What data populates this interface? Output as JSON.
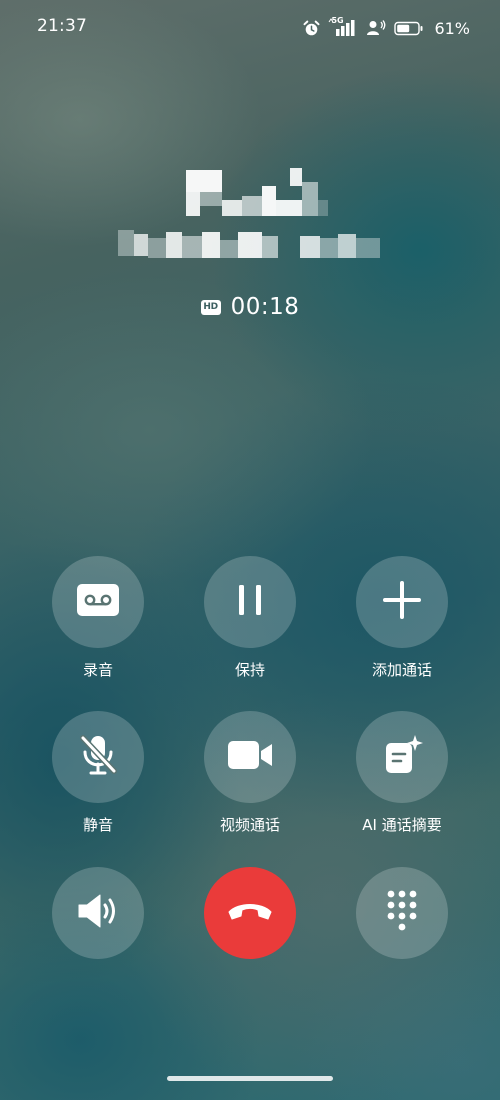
{
  "status_bar": {
    "time": "21:37",
    "network": "5G",
    "battery_percent": "61%",
    "battery_level": 0.61,
    "icons": [
      "alarm-icon",
      "signal-5g-icon",
      "hd-voice-icon",
      "battery-icon"
    ]
  },
  "call": {
    "hd_label": "HD",
    "duration": "00:18"
  },
  "controls": {
    "record": {
      "label": "录音",
      "icon": "voicemail-icon"
    },
    "hold": {
      "label": "保持",
      "icon": "pause-icon"
    },
    "add_call": {
      "label": "添加通话",
      "icon": "plus-icon"
    },
    "mute": {
      "label": "静音",
      "icon": "mic-off-icon"
    },
    "video_call": {
      "label": "视频通话",
      "icon": "video-camera-icon"
    },
    "ai_summary": {
      "label": "AI 通话摘要",
      "icon": "ai-note-icon"
    },
    "speaker": {
      "icon": "speaker-icon"
    },
    "end_call": {
      "icon": "hang-up-icon",
      "color": "#ea3b3a"
    },
    "keypad": {
      "icon": "dialpad-icon"
    }
  }
}
